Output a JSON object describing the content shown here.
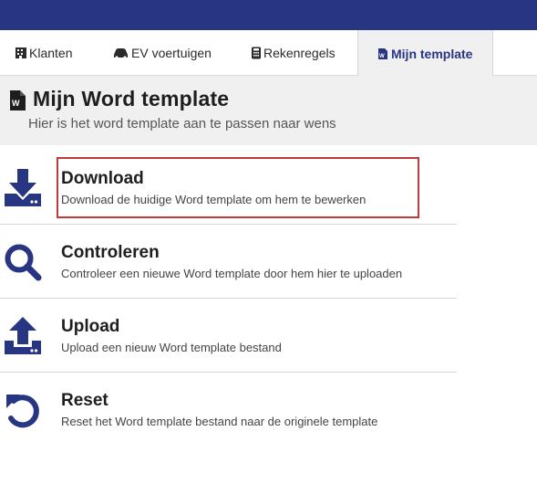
{
  "tabs": [
    {
      "label": "Klanten",
      "icon": "building-icon"
    },
    {
      "label": "EV voertuigen",
      "icon": "car-icon"
    },
    {
      "label": "Rekenregels",
      "icon": "calculator-icon"
    },
    {
      "label": "Mijn template",
      "icon": "word-file-icon",
      "active": true
    }
  ],
  "header": {
    "title": "Mijn Word template",
    "subtitle": "Hier is het word template aan te passen naar wens",
    "icon": "word-file-icon"
  },
  "actions": [
    {
      "title": "Download",
      "description": "Download de huidige Word template om hem te bewerken",
      "icon": "download-icon"
    },
    {
      "title": "Controleren",
      "description": "Controleer een nieuwe Word template door hem hier te uploaden",
      "icon": "search-icon"
    },
    {
      "title": "Upload",
      "description": "Upload een nieuw Word template bestand",
      "icon": "upload-icon"
    },
    {
      "title": "Reset",
      "description": "Reset het Word template bestand naar de originele template",
      "icon": "reset-icon"
    }
  ],
  "colors": {
    "brand": "#283583",
    "highlight": "#c0393b",
    "header_bg": "#f0f0f0"
  }
}
